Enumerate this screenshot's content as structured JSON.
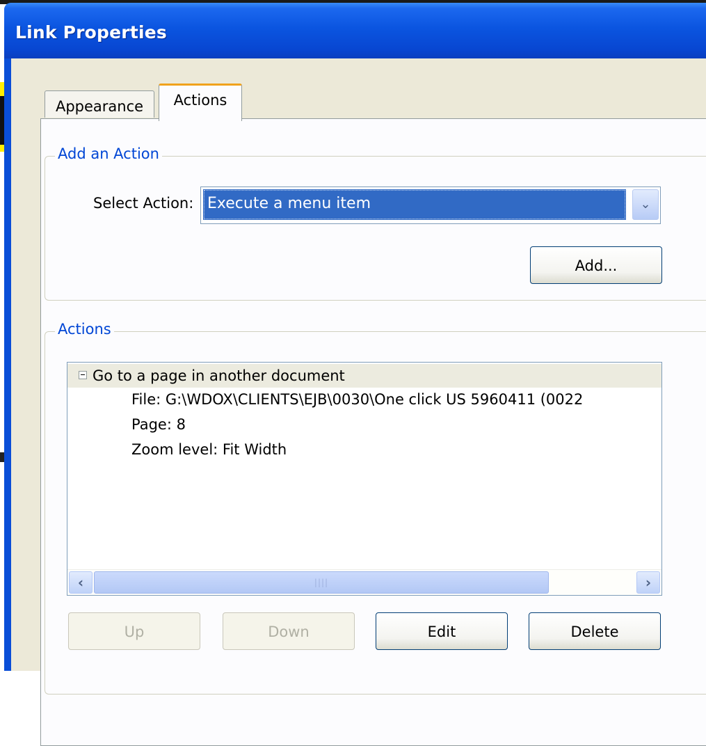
{
  "window": {
    "title": "Link Properties"
  },
  "tabs": [
    {
      "label": "Appearance",
      "selected": false
    },
    {
      "label": "Actions",
      "selected": true
    }
  ],
  "add_action": {
    "group_label": "Add an Action",
    "select_label": "Select Action:",
    "selected_value": "Execute a menu item",
    "add_button": "Add..."
  },
  "actions": {
    "group_label": "Actions",
    "tree": {
      "parent": "Go to a page in another document",
      "children": [
        "File: G:\\WDOX\\CLIENTS\\EJB\\0030\\One click US 5960411 (0022",
        "Page: 8",
        "Zoom level: Fit Width"
      ]
    },
    "buttons": {
      "up": "Up",
      "down": "Down",
      "edit": "Edit",
      "delete": "Delete"
    }
  },
  "icons": {
    "combo_arrow": "chevron-down-icon",
    "scroll_left": "chevron-left-icon",
    "scroll_right": "chevron-right-icon",
    "collapse": "minus-box-icon"
  },
  "colors": {
    "title_bar": "#0b55e0",
    "selection": "#316ac5",
    "group_label": "#0046d5",
    "tab_highlight": "#f0a21c"
  }
}
